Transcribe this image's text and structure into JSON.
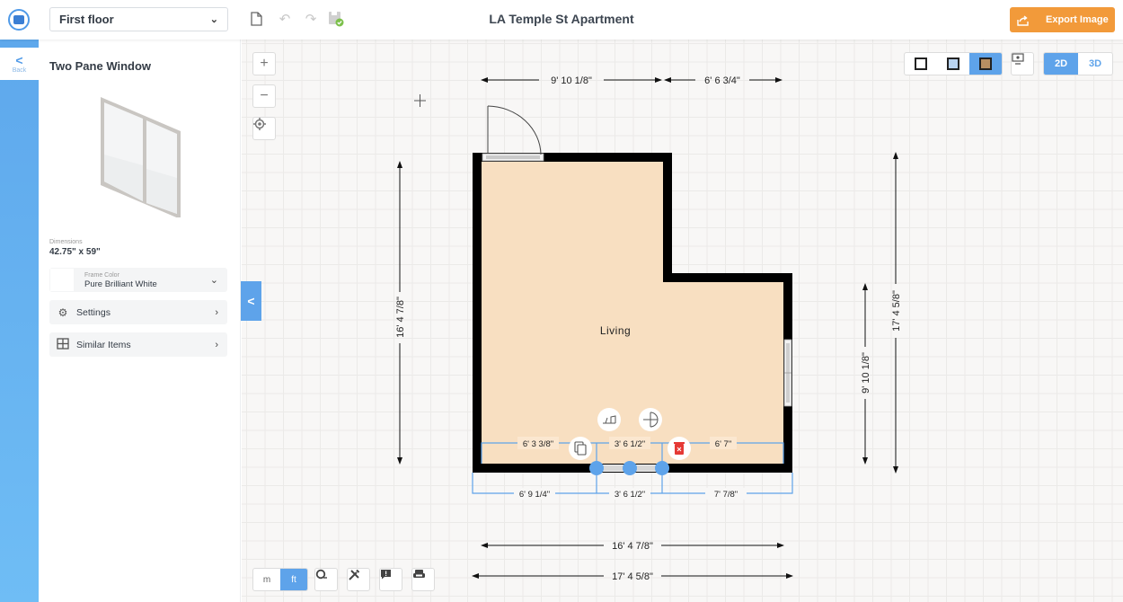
{
  "topbar": {
    "floor_select": "First floor",
    "title": "LA Temple St Apartment",
    "export_label": "Export Image"
  },
  "rail": {
    "back_label": "Back"
  },
  "panel": {
    "title": "Two Pane Window",
    "dimensions_label": "Dimensions",
    "dimensions_value": "42.75\" x 59\"",
    "frame_color_label": "Frame Color",
    "frame_color_value": "Pure Brilliant White",
    "settings_label": "Settings",
    "similar_label": "Similar Items"
  },
  "view": {
    "modes": [
      "outline",
      "blueprint",
      "textured"
    ],
    "active_mode": "textured",
    "dim_options": [
      "2D",
      "3D"
    ],
    "active_dim": "2D"
  },
  "units": {
    "options": [
      "m",
      "ft"
    ],
    "active": "ft"
  },
  "plan": {
    "room_name": "Living",
    "dimensions": {
      "top_left": "9' 10 1/8\"",
      "top_right": "6' 6 3/4\"",
      "left": "16' 4 7/8\"",
      "right_inner": "9' 10 1/8\"",
      "right_outer": "17' 4 5/8\"",
      "bottom_inner": "16' 4 7/8\"",
      "bottom_outer": "17' 4 5/8\""
    },
    "selected_window": {
      "inner_left": "6' 3 3/8\"",
      "inner_mid": "3' 6 1/2\"",
      "inner_right": "6' 7\"",
      "outer_left": "6' 9 1/4\"",
      "outer_mid": "3' 6 1/2\"",
      "outer_right": "7' 7/8\""
    }
  },
  "colors": {
    "accent": "#5ea3ea",
    "export": "#f29a3a",
    "room_fill": "#f8dfc1",
    "wall": "#000000",
    "delete": "#e53935"
  }
}
